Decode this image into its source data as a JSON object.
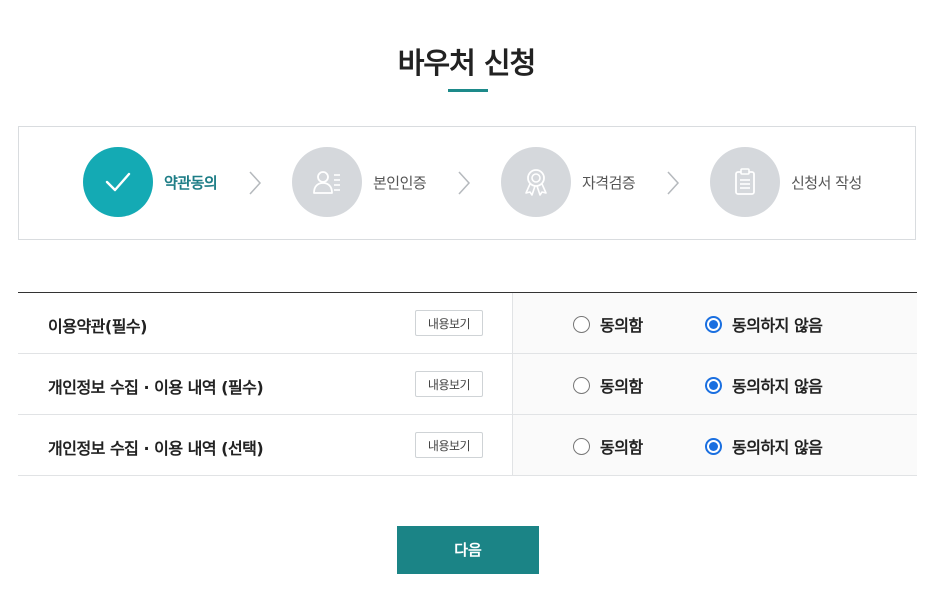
{
  "page": {
    "title": "바우처 신청"
  },
  "colors": {
    "accent": "#1b8486",
    "step_active": "#14aab4",
    "step_inactive": "#d5d8dc",
    "radio_checked": "#1a6fe0"
  },
  "steps": [
    {
      "label": "약관동의",
      "icon": "check-icon",
      "active": true
    },
    {
      "label": "본인인증",
      "icon": "person-id-icon",
      "active": false
    },
    {
      "label": "자격검증",
      "icon": "award-icon",
      "active": false
    },
    {
      "label": "신청서 작성",
      "icon": "clipboard-icon",
      "active": false
    }
  ],
  "agreements": [
    {
      "title": "이용약관(필수)",
      "view_label": "내용보기",
      "agree_label": "동의함",
      "disagree_label": "동의하지 않음",
      "selected": "disagree"
    },
    {
      "title": "개인정보 수집 · 이용 내역 (필수)",
      "view_label": "내용보기",
      "agree_label": "동의함",
      "disagree_label": "동의하지 않음",
      "selected": "disagree"
    },
    {
      "title": "개인정보 수집 · 이용 내역 (선택)",
      "view_label": "내용보기",
      "agree_label": "동의함",
      "disagree_label": "동의하지 않음",
      "selected": "disagree"
    }
  ],
  "actions": {
    "next_label": "다음"
  }
}
